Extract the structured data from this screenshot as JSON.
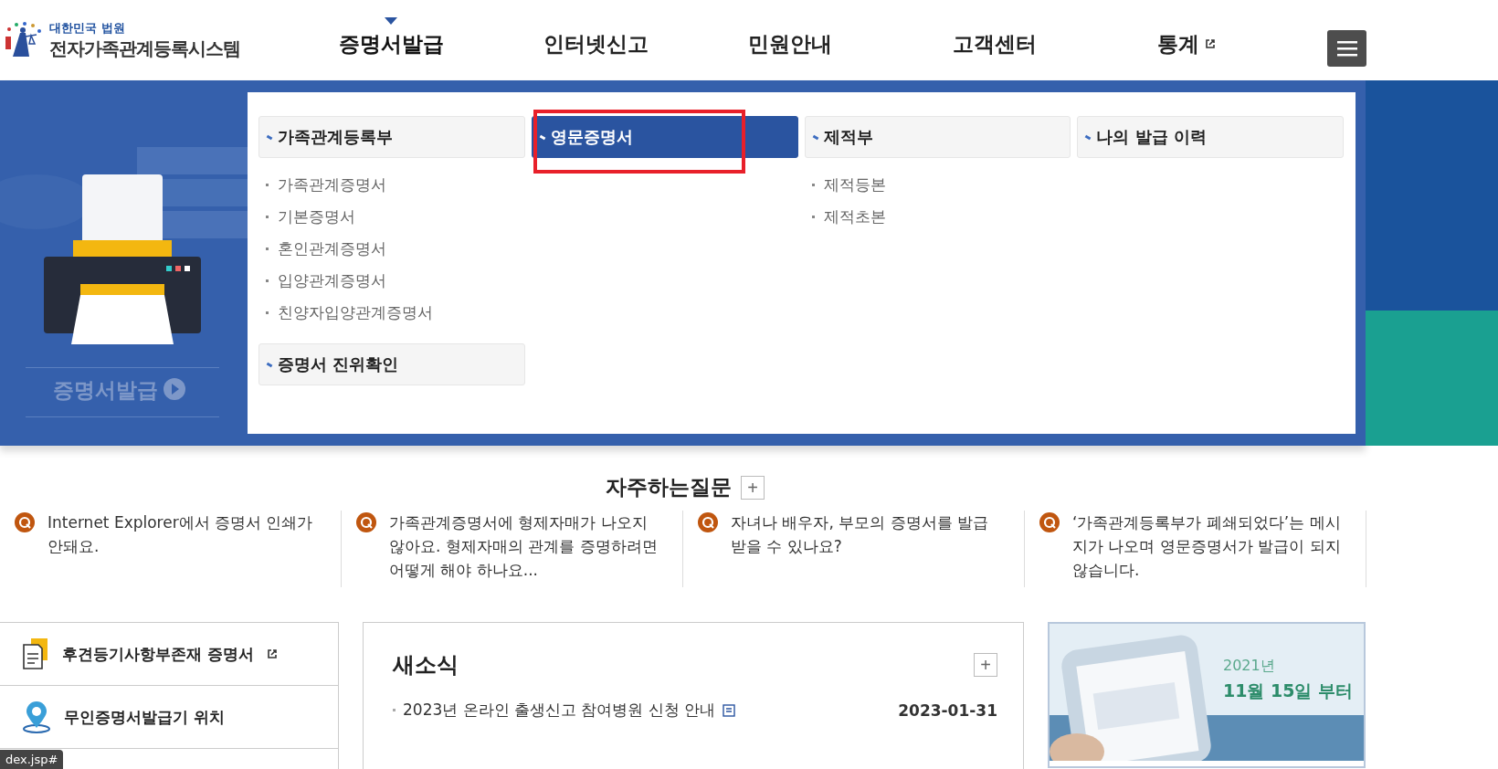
{
  "logo": {
    "org": "대한민국 법원",
    "title": "전자가족관계등록시스템"
  },
  "nav": [
    {
      "label": "증명서발급",
      "selected": true,
      "external": false
    },
    {
      "label": "인터넷신고",
      "selected": false,
      "external": false
    },
    {
      "label": "민원안내",
      "selected": false,
      "external": false
    },
    {
      "label": "고객센터",
      "selected": false,
      "external": false
    },
    {
      "label": "통계",
      "selected": false,
      "external": true
    }
  ],
  "mega_menu": {
    "promo_label": "증명서발급",
    "columns": [
      {
        "title": "가족관계등록부",
        "selected": false,
        "items": [
          "가족관계증명서",
          "기본증명서",
          "혼인관계증명서",
          "입양관계증명서",
          "친양자입양관계증명서"
        ],
        "extra": "증명서 진위확인"
      },
      {
        "title": "영문증명서",
        "selected": true,
        "highlighted": true
      },
      {
        "title": "제적부",
        "selected": false,
        "items": [
          "제적등본",
          "제적초본"
        ]
      },
      {
        "title": "나의 발급 이력",
        "selected": false
      }
    ]
  },
  "faq": {
    "title": "자주하는질문",
    "more": "+",
    "items": [
      "Internet Explorer에서 증명서 인쇄가 안돼요.",
      "가족관계증명서에 형제자매가 나오지 않아요. 형제자매의 관계를 증명하려면 어떻게 해야 하나요...",
      "자녀나 배우자, 부모의 증명서를 발급 받을 수 있나요?",
      "‘가족관계등록부가 폐쇄되었다’는 메시지가 나오며 영문증명서가 발급이 되지 않습니다."
    ]
  },
  "quick_links": [
    {
      "label": "후견등기사항부존재 증명서",
      "kind": "document",
      "external": true
    },
    {
      "label": "무인증명서발급기 위치",
      "kind": "location",
      "external": false
    }
  ],
  "news": {
    "title": "새소식",
    "more": "+",
    "items": [
      {
        "title": "2023년 온라인 출생신고 참여병원 신청 안내",
        "date": "2023-01-31"
      }
    ]
  },
  "banner": {
    "year": "2021년",
    "date": "11월 15일 부터"
  },
  "status_bar": "dex.jsp#"
}
